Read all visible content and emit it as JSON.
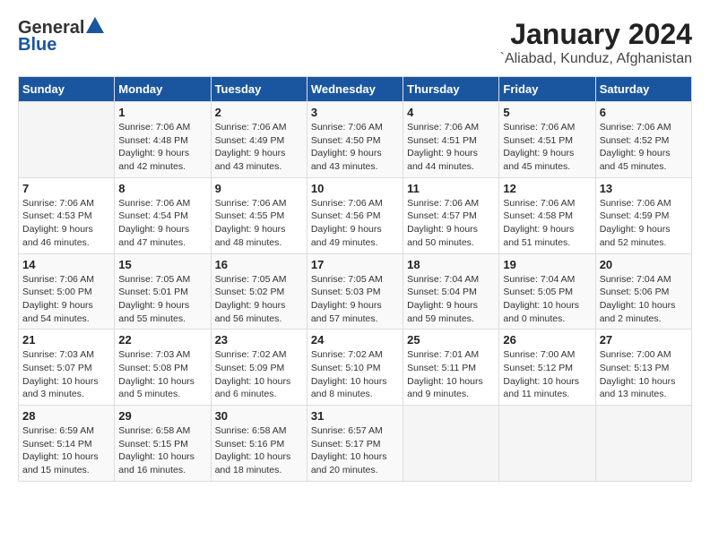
{
  "header": {
    "logo_general": "General",
    "logo_blue": "Blue",
    "title": "January 2024",
    "subtitle": "`Aliabad, Kunduz, Afghanistan"
  },
  "days_of_week": [
    "Sunday",
    "Monday",
    "Tuesday",
    "Wednesday",
    "Thursday",
    "Friday",
    "Saturday"
  ],
  "weeks": [
    [
      {
        "day": "",
        "info": ""
      },
      {
        "day": "1",
        "info": "Sunrise: 7:06 AM\nSunset: 4:48 PM\nDaylight: 9 hours\nand 42 minutes."
      },
      {
        "day": "2",
        "info": "Sunrise: 7:06 AM\nSunset: 4:49 PM\nDaylight: 9 hours\nand 43 minutes."
      },
      {
        "day": "3",
        "info": "Sunrise: 7:06 AM\nSunset: 4:50 PM\nDaylight: 9 hours\nand 43 minutes."
      },
      {
        "day": "4",
        "info": "Sunrise: 7:06 AM\nSunset: 4:51 PM\nDaylight: 9 hours\nand 44 minutes."
      },
      {
        "day": "5",
        "info": "Sunrise: 7:06 AM\nSunset: 4:51 PM\nDaylight: 9 hours\nand 45 minutes."
      },
      {
        "day": "6",
        "info": "Sunrise: 7:06 AM\nSunset: 4:52 PM\nDaylight: 9 hours\nand 45 minutes."
      }
    ],
    [
      {
        "day": "7",
        "info": "Sunrise: 7:06 AM\nSunset: 4:53 PM\nDaylight: 9 hours\nand 46 minutes."
      },
      {
        "day": "8",
        "info": "Sunrise: 7:06 AM\nSunset: 4:54 PM\nDaylight: 9 hours\nand 47 minutes."
      },
      {
        "day": "9",
        "info": "Sunrise: 7:06 AM\nSunset: 4:55 PM\nDaylight: 9 hours\nand 48 minutes."
      },
      {
        "day": "10",
        "info": "Sunrise: 7:06 AM\nSunset: 4:56 PM\nDaylight: 9 hours\nand 49 minutes."
      },
      {
        "day": "11",
        "info": "Sunrise: 7:06 AM\nSunset: 4:57 PM\nDaylight: 9 hours\nand 50 minutes."
      },
      {
        "day": "12",
        "info": "Sunrise: 7:06 AM\nSunset: 4:58 PM\nDaylight: 9 hours\nand 51 minutes."
      },
      {
        "day": "13",
        "info": "Sunrise: 7:06 AM\nSunset: 4:59 PM\nDaylight: 9 hours\nand 52 minutes."
      }
    ],
    [
      {
        "day": "14",
        "info": "Sunrise: 7:06 AM\nSunset: 5:00 PM\nDaylight: 9 hours\nand 54 minutes."
      },
      {
        "day": "15",
        "info": "Sunrise: 7:05 AM\nSunset: 5:01 PM\nDaylight: 9 hours\nand 55 minutes."
      },
      {
        "day": "16",
        "info": "Sunrise: 7:05 AM\nSunset: 5:02 PM\nDaylight: 9 hours\nand 56 minutes."
      },
      {
        "day": "17",
        "info": "Sunrise: 7:05 AM\nSunset: 5:03 PM\nDaylight: 9 hours\nand 57 minutes."
      },
      {
        "day": "18",
        "info": "Sunrise: 7:04 AM\nSunset: 5:04 PM\nDaylight: 9 hours\nand 59 minutes."
      },
      {
        "day": "19",
        "info": "Sunrise: 7:04 AM\nSunset: 5:05 PM\nDaylight: 10 hours\nand 0 minutes."
      },
      {
        "day": "20",
        "info": "Sunrise: 7:04 AM\nSunset: 5:06 PM\nDaylight: 10 hours\nand 2 minutes."
      }
    ],
    [
      {
        "day": "21",
        "info": "Sunrise: 7:03 AM\nSunset: 5:07 PM\nDaylight: 10 hours\nand 3 minutes."
      },
      {
        "day": "22",
        "info": "Sunrise: 7:03 AM\nSunset: 5:08 PM\nDaylight: 10 hours\nand 5 minutes."
      },
      {
        "day": "23",
        "info": "Sunrise: 7:02 AM\nSunset: 5:09 PM\nDaylight: 10 hours\nand 6 minutes."
      },
      {
        "day": "24",
        "info": "Sunrise: 7:02 AM\nSunset: 5:10 PM\nDaylight: 10 hours\nand 8 minutes."
      },
      {
        "day": "25",
        "info": "Sunrise: 7:01 AM\nSunset: 5:11 PM\nDaylight: 10 hours\nand 9 minutes."
      },
      {
        "day": "26",
        "info": "Sunrise: 7:00 AM\nSunset: 5:12 PM\nDaylight: 10 hours\nand 11 minutes."
      },
      {
        "day": "27",
        "info": "Sunrise: 7:00 AM\nSunset: 5:13 PM\nDaylight: 10 hours\nand 13 minutes."
      }
    ],
    [
      {
        "day": "28",
        "info": "Sunrise: 6:59 AM\nSunset: 5:14 PM\nDaylight: 10 hours\nand 15 minutes."
      },
      {
        "day": "29",
        "info": "Sunrise: 6:58 AM\nSunset: 5:15 PM\nDaylight: 10 hours\nand 16 minutes."
      },
      {
        "day": "30",
        "info": "Sunrise: 6:58 AM\nSunset: 5:16 PM\nDaylight: 10 hours\nand 18 minutes."
      },
      {
        "day": "31",
        "info": "Sunrise: 6:57 AM\nSunset: 5:17 PM\nDaylight: 10 hours\nand 20 minutes."
      },
      {
        "day": "",
        "info": ""
      },
      {
        "day": "",
        "info": ""
      },
      {
        "day": "",
        "info": ""
      }
    ]
  ]
}
